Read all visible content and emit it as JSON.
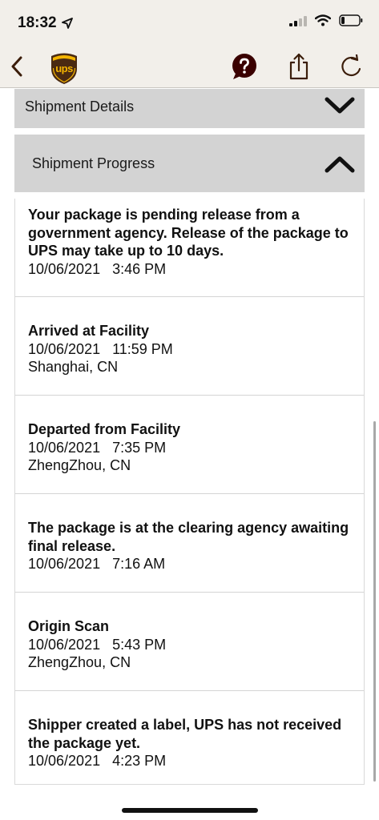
{
  "status_bar": {
    "time": "18:32"
  },
  "nav": {
    "back_icon": "chevron-left-icon",
    "logo_text": "ups",
    "help_icon": "help-bubble-icon",
    "share_icon": "share-icon",
    "refresh_icon": "refresh-icon"
  },
  "sections": {
    "details_label": "Shipment Details",
    "progress_label": "Shipment Progress"
  },
  "events": [
    {
      "title": "Your package is pending release from a government agency. Release of the package to UPS may take up to 10 days.",
      "datetime": "10/06/2021   3:46 PM",
      "location": ""
    },
    {
      "title": "Arrived at Facility",
      "datetime": "10/06/2021   11:59 PM",
      "location": "Shanghai, CN"
    },
    {
      "title": "Departed from Facility",
      "datetime": "10/06/2021   7:35 PM",
      "location": "ZhengZhou, CN"
    },
    {
      "title": "The package is at the clearing agency awaiting final release.",
      "datetime": "10/06/2021   7:16 AM",
      "location": ""
    },
    {
      "title": "Origin Scan",
      "datetime": "10/06/2021   5:43 PM",
      "location": "ZhengZhou, CN"
    },
    {
      "title": "Shipper created a label, UPS has not received the package yet.",
      "datetime": "10/06/2021   4:23 PM",
      "location": ""
    }
  ],
  "colors": {
    "header_bg": "#f2efea",
    "accordion_bg": "#d3d3d3",
    "ups_brown": "#4a2a12",
    "ups_gold": "#f4b400",
    "help_red": "#3a0000"
  }
}
